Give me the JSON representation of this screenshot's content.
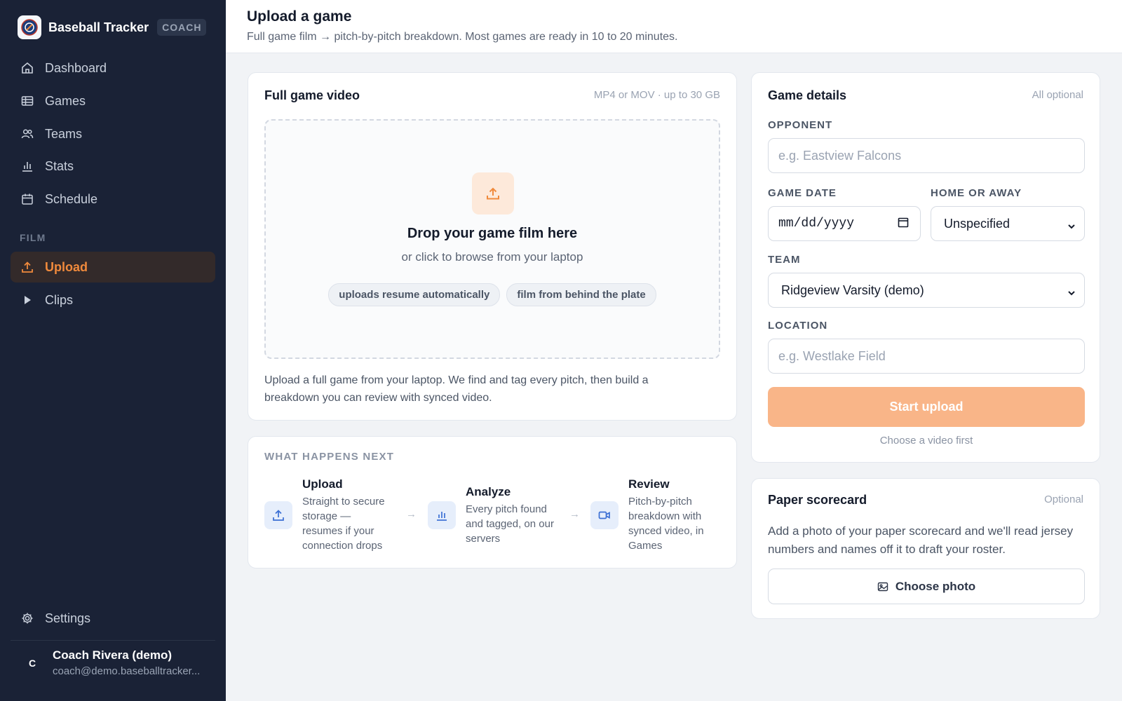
{
  "brand": {
    "name": "Baseball Tracker",
    "badge": "COACH",
    "logo_icon": "baseball-logo-icon"
  },
  "nav": {
    "items": [
      {
        "label": "Dashboard",
        "icon": "home-icon"
      },
      {
        "label": "Games",
        "icon": "table-icon"
      },
      {
        "label": "Teams",
        "icon": "users-icon"
      },
      {
        "label": "Stats",
        "icon": "bar-chart-icon"
      },
      {
        "label": "Schedule",
        "icon": "calendar-icon"
      }
    ],
    "section_label": "FILM",
    "film_items": [
      {
        "label": "Upload",
        "icon": "upload-icon",
        "active": true
      },
      {
        "label": "Clips",
        "icon": "play-icon",
        "active": false
      }
    ],
    "settings_label": "Settings"
  },
  "user": {
    "initial": "C",
    "name": "Coach Rivera (demo)",
    "email": "coach@demo.baseballtracker..."
  },
  "header": {
    "title": "Upload a game",
    "subtitle": "Full game film → pitch-by-pitch breakdown. Most games are ready in 10 to 20 minutes."
  },
  "video_card": {
    "title": "Full game video",
    "meta": "MP4 or MOV · up to 30 GB",
    "drop_title": "Drop your game film here",
    "drop_sub": "or click to browse from your laptop",
    "chips": [
      "uploads resume automatically",
      "film from behind the plate"
    ],
    "description": "Upload a full game from your laptop. We find and tag every pitch, then build a breakdown you can review with synced video."
  },
  "next_card": {
    "label": "WHAT HAPPENS NEXT",
    "steps": [
      {
        "title": "Upload",
        "desc": "Straight to secure storage — resumes if your connection drops",
        "icon": "upload-icon"
      },
      {
        "title": "Analyze",
        "desc": "Every pitch found and tagged, on our servers",
        "icon": "bar-chart-icon"
      },
      {
        "title": "Review",
        "desc": "Pitch-by-pitch breakdown with synced video, in Games",
        "icon": "video-icon"
      }
    ],
    "arrow": "→"
  },
  "details_card": {
    "title": "Game details",
    "meta": "All optional",
    "opponent": {
      "label": "OPPONENT",
      "placeholder": "e.g. Eastview Falcons",
      "value": ""
    },
    "game_date": {
      "label": "GAME DATE",
      "value": "mm/dd/yyyy"
    },
    "home_away": {
      "label": "HOME OR AWAY",
      "value": "Unspecified"
    },
    "team": {
      "label": "TEAM",
      "value": "Ridgeview Varsity (demo)"
    },
    "location": {
      "label": "LOCATION",
      "placeholder": "e.g. Westlake Field",
      "value": ""
    },
    "start_button": "Start upload",
    "hint": "Choose a video first",
    "accent_color": "#f9b588"
  },
  "paper_card": {
    "title": "Paper scorecard",
    "meta": "Optional",
    "description": "Add a photo of your paper scorecard and we'll read jersey numbers and names off it to draft your roster.",
    "button": "Choose photo"
  }
}
